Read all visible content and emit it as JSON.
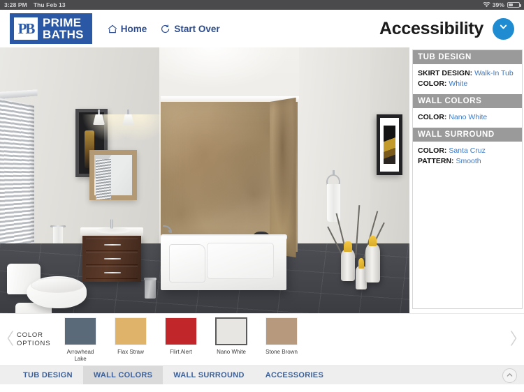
{
  "status_bar": {
    "time": "3:28 PM",
    "date": "Thu Feb 13",
    "battery_percent": "39%",
    "wifi_icon": "wifi-icon",
    "battery_icon": "battery-icon"
  },
  "header": {
    "logo": {
      "mark": "PB",
      "line1": "PRIME",
      "line2": "BATHS",
      "brand_color": "#2a58a5"
    },
    "nav": [
      {
        "label": "Home",
        "icon": "home-icon"
      },
      {
        "label": "Start Over",
        "icon": "refresh-icon"
      }
    ],
    "title": "Accessibility",
    "chevron_button": {
      "icon": "chevron-down-icon",
      "color": "#1f8bd0"
    }
  },
  "info_panel": {
    "sections": [
      {
        "heading": "TUB DESIGN",
        "rows": [
          {
            "key": "SKIRT DESIGN:",
            "value": "Walk-In Tub"
          },
          {
            "key": "COLOR:",
            "value": "White"
          }
        ]
      },
      {
        "heading": "WALL COLORS",
        "rows": [
          {
            "key": "COLOR:",
            "value": "Nano White"
          }
        ]
      },
      {
        "heading": "WALL SURROUND",
        "rows": [
          {
            "key": "COLOR:",
            "value": "Santa Cruz"
          },
          {
            "key": "PATTERN:",
            "value": "Smooth"
          }
        ]
      }
    ],
    "heading_bg": "#9a9a9a",
    "value_color": "#3b78c4"
  },
  "color_options": {
    "label_line1": "COLOR",
    "label_line2": "OPTIONS",
    "prev_icon": "chevron-left-icon",
    "next_icon": "chevron-right-icon",
    "swatches": [
      {
        "name": "Arrowhead Lake",
        "color": "#5a6a79",
        "selected": false
      },
      {
        "name": "Flax Straw",
        "color": "#e0b36a",
        "selected": false
      },
      {
        "name": "Flirt Alert",
        "color": "#c0262a",
        "selected": false
      },
      {
        "name": "Nano White",
        "color": "#e8e6e2",
        "selected": true
      },
      {
        "name": "Stone Brown",
        "color": "#b79a7e",
        "selected": false
      }
    ]
  },
  "tabs": [
    {
      "label": "TUB DESIGN",
      "active": false
    },
    {
      "label": "WALL COLORS",
      "active": true
    },
    {
      "label": "WALL SURROUND",
      "active": false
    },
    {
      "label": "ACCESSORIES",
      "active": false
    }
  ],
  "collapse_button": {
    "icon": "chevron-up-icon"
  },
  "scene": {
    "description": "Bathroom 3D render preview",
    "wall_color": "#e8e6e2",
    "surround_color": "#c0a87f",
    "floor_color": "#44464b"
  }
}
